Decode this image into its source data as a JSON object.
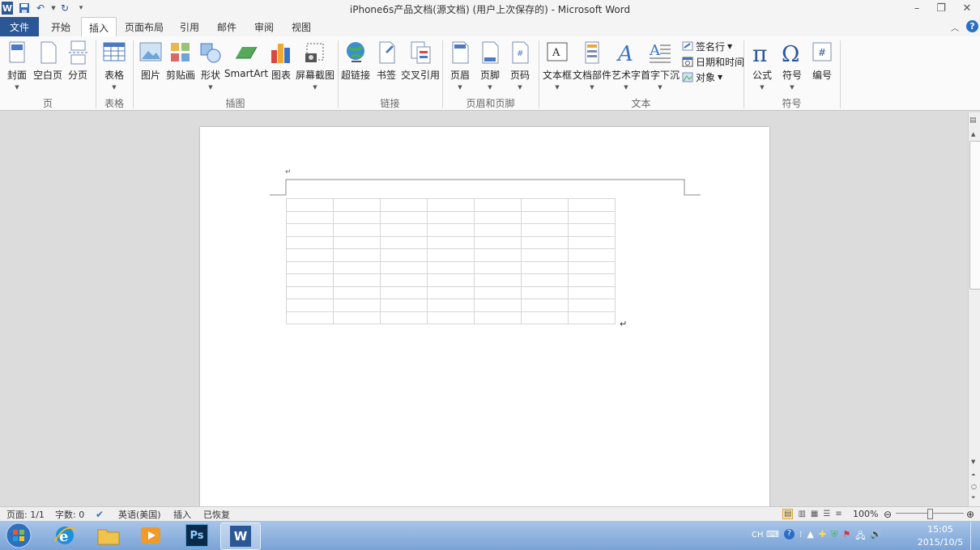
{
  "window": {
    "title": "iPhone6s产品文档(源文档) (用户上次保存的)  -  Microsoft Word",
    "app_icon": "W",
    "minimize": "–",
    "restore": "❐",
    "close": "✕"
  },
  "tabs": [
    {
      "label": "文件"
    },
    {
      "label": "开始"
    },
    {
      "label": "插入"
    },
    {
      "label": "页面布局"
    },
    {
      "label": "引用"
    },
    {
      "label": "邮件"
    },
    {
      "label": "审阅"
    },
    {
      "label": "视图"
    }
  ],
  "ribbon": {
    "groups": [
      "页",
      "表格",
      "插图",
      "链接",
      "页眉和页脚",
      "文本",
      "符号"
    ],
    "buttons": {
      "cover": "封面",
      "blank_page": "空白页",
      "page_break": "分页",
      "table": "表格",
      "picture": "图片",
      "clipart": "剪贴画",
      "shapes": "形状",
      "smartart": "SmartArt",
      "chart": "图表",
      "screenshot": "屏幕截图",
      "hyperlink": "超链接",
      "bookmark": "书签",
      "cross_ref": "交叉引用",
      "header": "页眉",
      "footer": "页脚",
      "page_number": "页码",
      "textbox": "文本框",
      "quick_parts": "文档部件",
      "wordart": "艺术字",
      "dropcap": "首字下沉",
      "signature_line": "签名行",
      "datetime": "日期和时间",
      "object": "对象",
      "equation": "公式",
      "symbol": "符号",
      "numbering": "编号"
    }
  },
  "document": {
    "table_rows": 10,
    "table_cols": 7,
    "paragraph_mark": "↵"
  },
  "status": {
    "page": "页面: 1/1",
    "words": "字数: 0",
    "language": "英语(美国)",
    "insert_mode": "插入",
    "recovered": "已恢复",
    "zoom": "100%",
    "zoom_level": 1.0
  },
  "taskbar": {
    "ime": "CH",
    "time": "15:05",
    "date": "2015/10/5"
  },
  "colors": {
    "file_tab": "#2b5797",
    "word_blue": "#2b5797",
    "taskbar": "#8fb2e0"
  }
}
